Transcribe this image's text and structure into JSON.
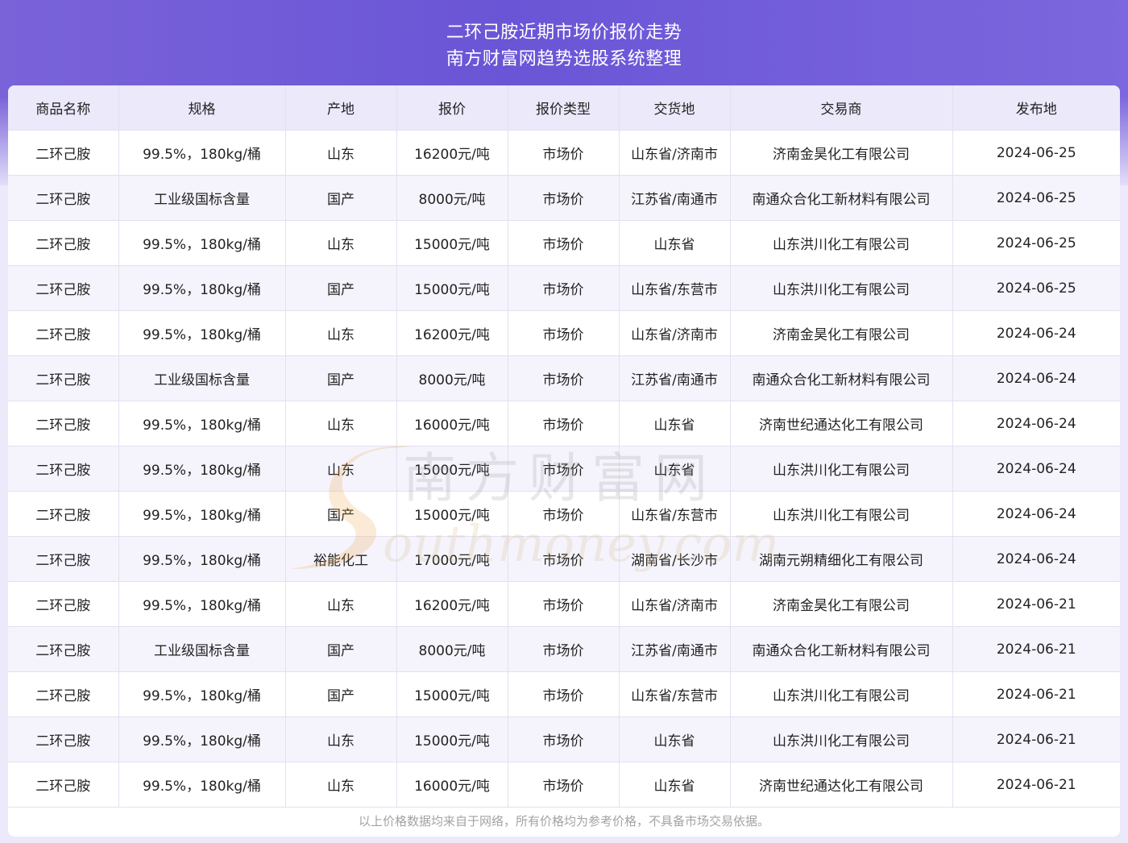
{
  "header": {
    "title_line1": "二环己胺近期市场价报价走势",
    "title_line2": "南方财富网趋势选股系统整理"
  },
  "table": {
    "columns": [
      "商品名称",
      "规格",
      "产地",
      "报价",
      "报价类型",
      "交货地",
      "交易商",
      "发布地"
    ],
    "rows": [
      [
        "二环己胺",
        "99.5%，180kg/桶",
        "山东",
        "16200元/吨",
        "市场价",
        "山东省/济南市",
        "济南金昊化工有限公司",
        "2024-06-25"
      ],
      [
        "二环己胺",
        "工业级国标含量",
        "国产",
        "8000元/吨",
        "市场价",
        "江苏省/南通市",
        "南通众合化工新材料有限公司",
        "2024-06-25"
      ],
      [
        "二环己胺",
        "99.5%，180kg/桶",
        "山东",
        "15000元/吨",
        "市场价",
        "山东省",
        "山东洪川化工有限公司",
        "2024-06-25"
      ],
      [
        "二环己胺",
        "99.5%，180kg/桶",
        "国产",
        "15000元/吨",
        "市场价",
        "山东省/东营市",
        "山东洪川化工有限公司",
        "2024-06-25"
      ],
      [
        "二环己胺",
        "99.5%，180kg/桶",
        "山东",
        "16200元/吨",
        "市场价",
        "山东省/济南市",
        "济南金昊化工有限公司",
        "2024-06-24"
      ],
      [
        "二环己胺",
        "工业级国标含量",
        "国产",
        "8000元/吨",
        "市场价",
        "江苏省/南通市",
        "南通众合化工新材料有限公司",
        "2024-06-24"
      ],
      [
        "二环己胺",
        "99.5%，180kg/桶",
        "山东",
        "16000元/吨",
        "市场价",
        "山东省",
        "济南世纪通达化工有限公司",
        "2024-06-24"
      ],
      [
        "二环己胺",
        "99.5%，180kg/桶",
        "山东",
        "15000元/吨",
        "市场价",
        "山东省",
        "山东洪川化工有限公司",
        "2024-06-24"
      ],
      [
        "二环己胺",
        "99.5%，180kg/桶",
        "国产",
        "15000元/吨",
        "市场价",
        "山东省/东营市",
        "山东洪川化工有限公司",
        "2024-06-24"
      ],
      [
        "二环己胺",
        "99.5%，180kg/桶",
        "裕能化工",
        "17000元/吨",
        "市场价",
        "湖南省/长沙市",
        "湖南元朔精细化工有限公司",
        "2024-06-24"
      ],
      [
        "二环己胺",
        "99.5%，180kg/桶",
        "山东",
        "16200元/吨",
        "市场价",
        "山东省/济南市",
        "济南金昊化工有限公司",
        "2024-06-21"
      ],
      [
        "二环己胺",
        "工业级国标含量",
        "国产",
        "8000元/吨",
        "市场价",
        "江苏省/南通市",
        "南通众合化工新材料有限公司",
        "2024-06-21"
      ],
      [
        "二环己胺",
        "99.5%，180kg/桶",
        "国产",
        "15000元/吨",
        "市场价",
        "山东省/东营市",
        "山东洪川化工有限公司",
        "2024-06-21"
      ],
      [
        "二环己胺",
        "99.5%，180kg/桶",
        "山东",
        "15000元/吨",
        "市场价",
        "山东省",
        "山东洪川化工有限公司",
        "2024-06-21"
      ],
      [
        "二环己胺",
        "99.5%，180kg/桶",
        "山东",
        "16000元/吨",
        "市场价",
        "山东省",
        "济南世纪通达化工有限公司",
        "2024-06-21"
      ]
    ]
  },
  "footer": {
    "note": "以上价格数据均来自于网络，所有价格均为参考价格，不具备市场交易依据。"
  },
  "watermark": {
    "text_cn": "南方财富网",
    "text_en": "outhmoney.com"
  },
  "colors": {
    "banner": "#6a55d6",
    "header_row": "#ece9fb",
    "stripe": "#f5f4fc"
  }
}
